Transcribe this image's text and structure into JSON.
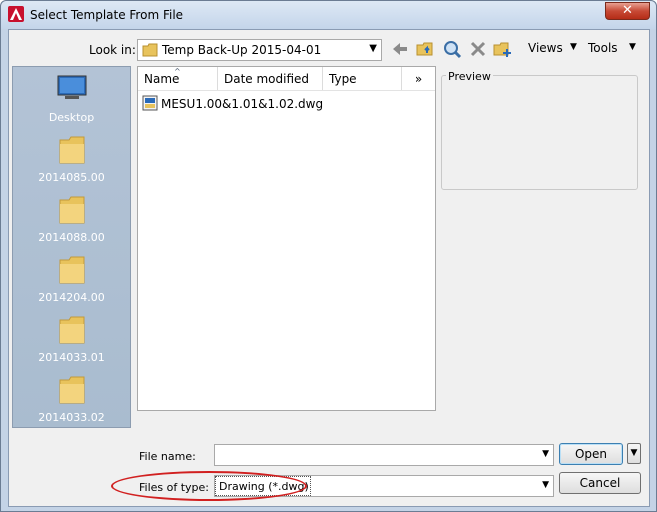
{
  "window": {
    "title": "Select Template From File",
    "close_label": "✕"
  },
  "toolbar": {
    "lookin_label": "Look in:",
    "lookin_value": "Temp Back-Up 2015-04-01",
    "views_label": "Views",
    "tools_label": "Tools"
  },
  "places": [
    {
      "label": "Desktop",
      "icon": "desktop-icon"
    },
    {
      "label": "2014085.00",
      "icon": "folder-icon"
    },
    {
      "label": "2014088.00",
      "icon": "folder-icon"
    },
    {
      "label": "2014204.00",
      "icon": "folder-icon"
    },
    {
      "label": "2014033.01",
      "icon": "folder-icon"
    },
    {
      "label": "2014033.02",
      "icon": "folder-icon"
    }
  ],
  "filelist": {
    "columns": [
      "Name",
      "Date modified",
      "Type",
      "»"
    ],
    "files": [
      {
        "name": "MESU1.00&1.01&1.02.dwg",
        "icon": "dwg-file-icon"
      }
    ]
  },
  "preview": {
    "label": "Preview"
  },
  "form": {
    "filename_label": "File name:",
    "filename_value": "",
    "filetype_label": "Files of type:",
    "filetype_value": "Drawing (*.dwg)",
    "open_label": "Open",
    "cancel_label": "Cancel"
  },
  "colors": {
    "accent": "#c8102e",
    "highlight_ellipse": "#d12020",
    "places_bg": "#a9bccf"
  }
}
